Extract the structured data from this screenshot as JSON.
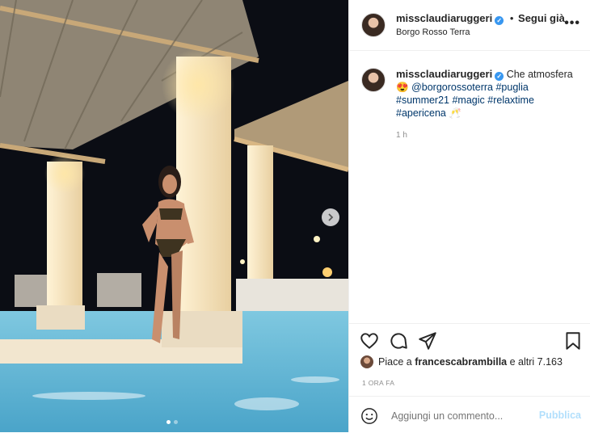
{
  "post": {
    "username": "missclaudiaruggeri",
    "follow_separator": "•",
    "follow_label": "Segui già",
    "location": "Borgo Rosso Terra",
    "more_label": "•••"
  },
  "caption": {
    "username": "missclaudiaruggeri",
    "text": "Che atmosfera",
    "emoji_1": "😍",
    "tags": [
      "@borgorossoterra",
      "#puglia",
      "#summer21",
      "#magic",
      "#relaxtime",
      "#apericena"
    ],
    "emoji_2": "🥂",
    "time": "1 h"
  },
  "likes": {
    "prefix": "Piace a",
    "user": "francescabrambilla",
    "suffix": "e altri 7.163"
  },
  "posted_ago": "1 ORA FA",
  "comment": {
    "placeholder": "Aggiungi un commento...",
    "publish_label": "Pubblica"
  },
  "carousel": {
    "total": 2,
    "current": 1
  },
  "colors": {
    "link": "#00376b",
    "verified": "#3897f0",
    "publish_disabled": "#b2dffc"
  },
  "icons": [
    "heart-icon",
    "comment-icon",
    "share-icon",
    "bookmark-icon",
    "emoji-icon",
    "chevron-right-icon",
    "verified-icon",
    "more-icon"
  ]
}
